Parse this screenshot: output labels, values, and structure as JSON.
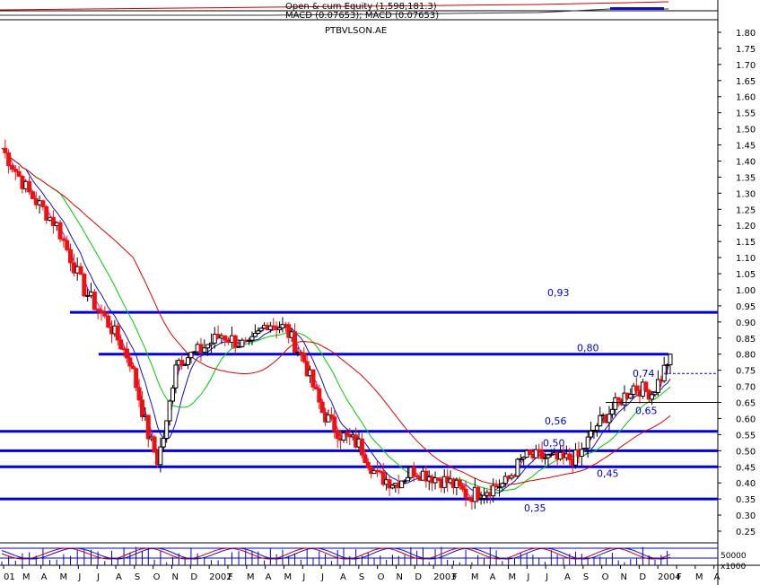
{
  "header": {
    "line1": "Open & cum Equity (1,598,181.3)",
    "line2": "MACD (0.07653); MACD (0.07653)",
    "symbol": "PTBVLSON.AE"
  },
  "colors": {
    "background": "#ffffff",
    "level_line": "#0000dd",
    "level_text": "#0000cc",
    "up_candle": "#000000",
    "down_candle": "#ee1111",
    "ma_fast": "#1010cc",
    "ma_mid": "#00cc00",
    "ma_slow": "#dd0000",
    "ma_short": "#cc00cc",
    "grid_text": "#000000"
  },
  "chart_data": {
    "type": "candlestick",
    "symbol": "PTBVLSON.AE",
    "ylim": [
      0.2,
      1.85
    ],
    "yticks": [
      "1.80",
      "1.75",
      "1.70",
      "1.65",
      "1.60",
      "1.55",
      "1.50",
      "1.45",
      "1.40",
      "1.35",
      "1.30",
      "1.25",
      "1.20",
      "1.15",
      "1.10",
      "1.05",
      "1.00",
      "0.95",
      "0.90",
      "0.85",
      "0.80",
      "0.75",
      "0.70",
      "0.65",
      "0.60",
      "0.55",
      "0.50",
      "0.45",
      "0.40",
      "0.35",
      "0.30",
      "0.25"
    ],
    "x_labels": [
      "01",
      "M",
      "A",
      "M",
      "J",
      "J",
      "A",
      "S",
      "O",
      "N",
      "D",
      "2002",
      "F",
      "M",
      "A",
      "M",
      "J",
      "J",
      "A",
      "S",
      "O",
      "N",
      "D",
      "2003",
      "F",
      "M",
      "A",
      "M",
      "J",
      "J",
      "A",
      "S",
      "O",
      "N",
      "D",
      "2004",
      "F",
      "M",
      "A"
    ],
    "levels": [
      {
        "value": 0.93,
        "label": "0,93"
      },
      {
        "value": 0.8,
        "label": "0,80"
      },
      {
        "value": 0.56,
        "label": "0,56"
      },
      {
        "value": 0.5,
        "label": "0,50"
      },
      {
        "value": 0.45,
        "label": "0,45"
      },
      {
        "value": 0.35,
        "label": "0,35"
      }
    ],
    "annotations": [
      {
        "value": 0.74,
        "label": "0,74"
      },
      {
        "value": 0.65,
        "label": "0,65"
      }
    ],
    "price_path": [
      [
        0,
        1.44
      ],
      [
        3,
        1.3
      ],
      [
        6,
        1.2
      ],
      [
        9,
        1.0
      ],
      [
        12,
        0.88
      ],
      [
        14,
        0.78
      ],
      [
        16,
        0.55
      ],
      [
        17,
        0.47
      ],
      [
        18,
        0.58
      ],
      [
        19,
        0.78
      ],
      [
        21,
        0.8
      ],
      [
        24,
        0.86
      ],
      [
        27,
        0.82
      ],
      [
        29,
        0.9
      ],
      [
        31,
        0.88
      ],
      [
        33,
        0.78
      ],
      [
        35,
        0.62
      ],
      [
        37,
        0.55
      ],
      [
        39,
        0.52
      ],
      [
        41,
        0.42
      ],
      [
        43,
        0.4
      ],
      [
        45,
        0.44
      ],
      [
        47,
        0.42
      ],
      [
        49,
        0.4
      ],
      [
        51,
        0.36
      ],
      [
        53,
        0.38
      ],
      [
        55,
        0.4
      ],
      [
        57,
        0.48
      ],
      [
        59,
        0.48
      ],
      [
        61,
        0.47
      ],
      [
        63,
        0.48
      ],
      [
        65,
        0.58
      ],
      [
        67,
        0.64
      ],
      [
        69,
        0.7
      ],
      [
        71,
        0.68
      ],
      [
        72,
        0.73
      ],
      [
        73,
        0.8
      ]
    ],
    "volume_label": "x1000",
    "volume_tick": "50000"
  }
}
